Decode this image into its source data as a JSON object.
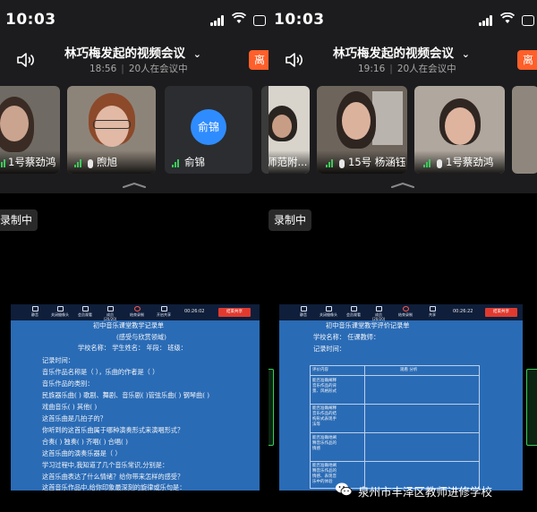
{
  "status": {
    "time": "10:03"
  },
  "left": {
    "title": "林巧梅发起的视频会议",
    "start_time": "18:56",
    "participants": "20人在会议中",
    "leave_label": "离",
    "tiles": [
      "1号蔡劲鸿",
      "煦旭",
      "俞锦"
    ],
    "avatar_text": "俞锦",
    "recording": "录制中"
  },
  "right": {
    "title": "林巧梅发起的视频会议",
    "start_time": "19:16",
    "participants": "20人在会议中",
    "leave_label": "离",
    "tiles": [
      "师范附...",
      "15号 杨涵钰",
      "1号蔡劲鸿"
    ],
    "recording": "录制中"
  },
  "share_toolbar": {
    "items": [
      "静音",
      "关闭摄像头",
      "会员观看",
      "成员(20/20)",
      "结束录制",
      "开启共享",
      "共享"
    ],
    "left_timer": "00:26:02",
    "right_timer": "00:26:22",
    "end_label": "结束共享"
  },
  "doc_left": {
    "title": "初中音乐课堂教学记录单",
    "subtitle": "(感受与欣赏领域)",
    "lines": [
      "学校名称：    学生姓名：    年段：    班级：",
      "记录时间：",
      "音乐作品名称是（    ），乐曲的作者是（    ）",
      "音乐作品的类别：",
      "民族器乐曲(  ) 歌剧、舞剧、音乐剧(  )管弦乐曲(  ) 钢琴曲(  )",
      "戏曲音乐(  )    其他(  )",
      "这首乐曲是几拍子的？",
      "你听到的这首乐曲属于哪种演奏形式来演唱形式？",
      "合奏(  )    独奏(  )    齐唱(  )    合唱(  )",
      "这首乐曲的演奏乐器是（    ）",
      "学习过程中,我知道了几个音乐常识,分别是：",
      "这首乐曲表达了什么情绪？给你带来怎样的感受？",
      "这首音乐作品中,给你印象最深刻的旋律或乐句是："
    ]
  },
  "doc_right": {
    "title": "初中音乐课堂教学评价记录单",
    "lines": [
      "学校名称：      任课教师：",
      "记录时间："
    ],
    "table_header": [
      "评价内容",
      "观看  分析"
    ],
    "table_rows": [
      "能否准确阐释\n音乐作品的背\n景、风格形式",
      "能否准确阐释\n音乐作品的结\n构形式表现手\n法等",
      "能否准确地阐\n释音乐作品的\n情感",
      "能否准确地阐\n释音乐作品的\n情感、表现音\n乐中的体验"
    ]
  },
  "watermark": {
    "text": "泉州市丰泽区教师进修学校"
  },
  "colors": {
    "leave": "#ff5f2a",
    "avatar": "#2f8cff",
    "share_bg": "#2a6bb5",
    "signal": "#3ccb5a"
  }
}
